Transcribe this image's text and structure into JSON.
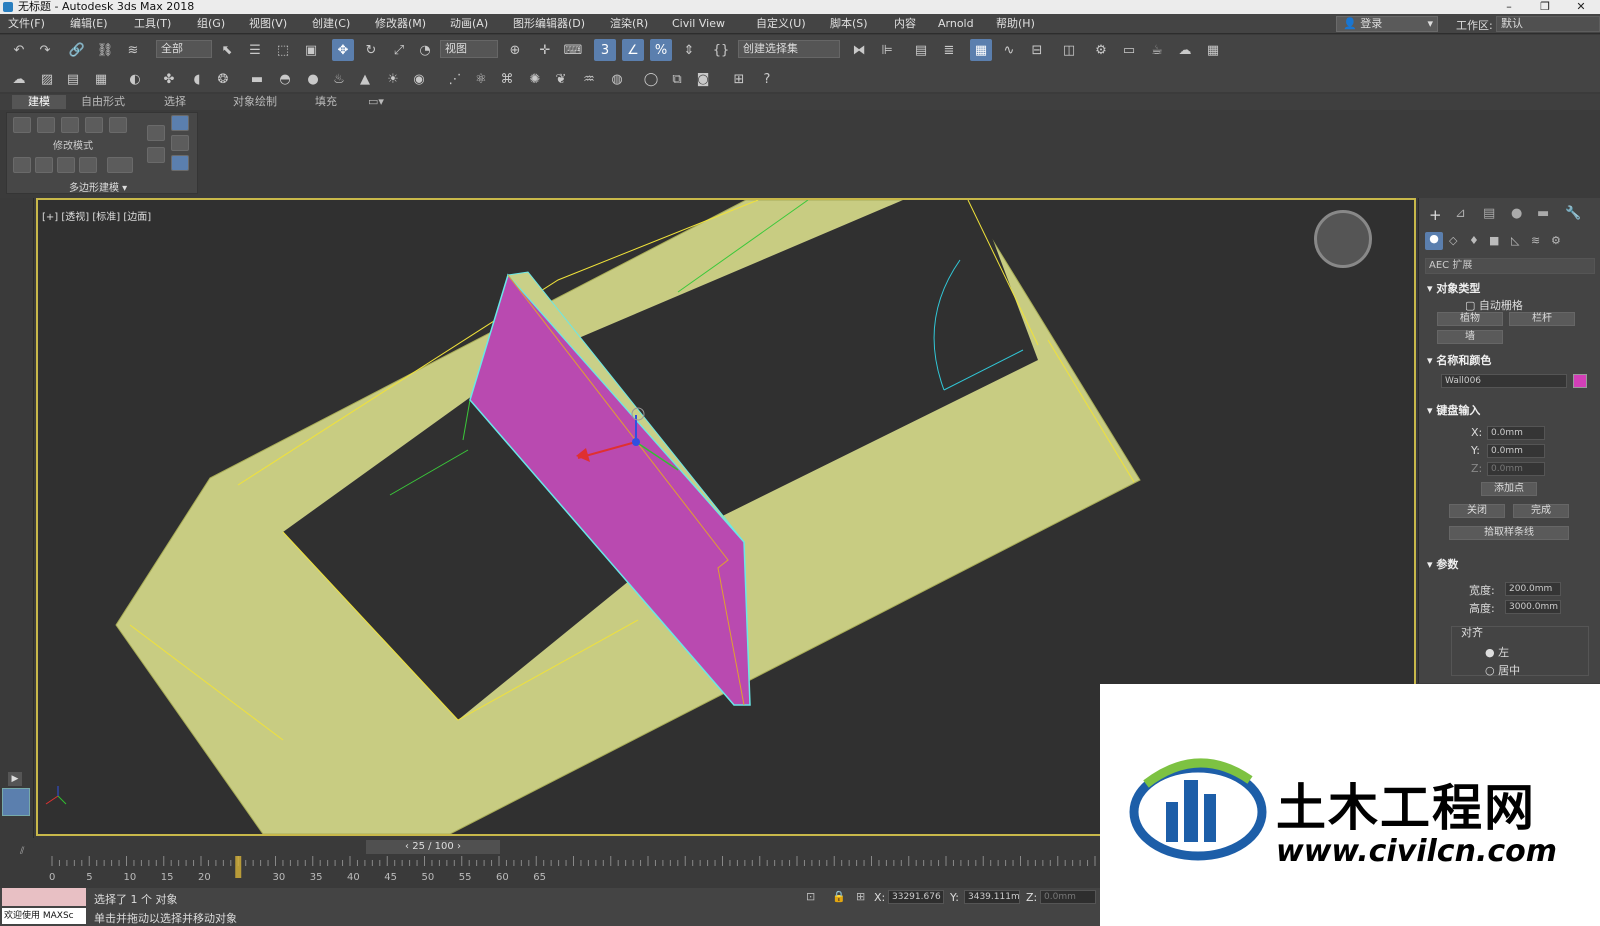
{
  "window": {
    "title": "无标题 - Autodesk 3ds Max 2018",
    "controls": [
      "–",
      "❐",
      "✕"
    ]
  },
  "menu": [
    "文件(F)",
    "编辑(E)",
    "工具(T)",
    "组(G)",
    "视图(V)",
    "创建(C)",
    "修改器(M)",
    "动画(A)",
    "图形编辑器(D)",
    "渲染(R)",
    "Civil View",
    "自定义(U)",
    "脚本(S)",
    "内容",
    "Arnold",
    "帮助(H)"
  ],
  "login": "登录",
  "workspace_label": "工作区:",
  "workspace_value": "默认",
  "toolbar": {
    "filter": "全部",
    "ref_coord": "视图",
    "selection_set": "创建选择集"
  },
  "ribbon": {
    "tabs": [
      "建模",
      "自由形式",
      "选择",
      "对象绘制",
      "填充"
    ],
    "active_tab": "建模",
    "group_label": "修改模式",
    "dropdown": "多边形建模 ▾"
  },
  "viewport": {
    "label": "[+] [透视] [标准] [边面]"
  },
  "cmd": {
    "category": "AEC 扩展",
    "rollout_object_type": "对象类型",
    "autogrid": "自动栅格",
    "btn_foliage": "植物",
    "btn_railing": "栏杆",
    "btn_wall": "墙",
    "rollout_name": "名称和颜色",
    "object_name": "Wall006",
    "object_color": "#d33fb8",
    "rollout_keyboard": "键盘输入",
    "x_label": "X:",
    "x_value": "0.0mm",
    "y_label": "Y:",
    "y_value": "0.0mm",
    "z_label": "Z:",
    "z_value": "0.0mm",
    "add_point": "添加点",
    "close": "关闭",
    "finish": "完成",
    "pick_spline": "拾取样条线",
    "rollout_params": "参数",
    "width_label": "宽度:",
    "width_value": "200.0mm",
    "height_label": "高度:",
    "height_value": "3000.0mm",
    "justify_label": "对齐",
    "justify_left": "左",
    "justify_center": "居中"
  },
  "timeline": {
    "frame": "25 / 100",
    "current_frame": 25,
    "ticks": [
      "0",
      "5",
      "10",
      "15",
      "20",
      "30",
      "35",
      "40",
      "45",
      "50",
      "55",
      "60",
      "65"
    ]
  },
  "status": {
    "selected": "选择了 1 个 对象",
    "hint": "单击并拖动以选择并移动对象",
    "welcome": "欢迎使用 MAXSc",
    "x_label": "X:",
    "x_value": "33291.676",
    "y_label": "Y:",
    "y_value": "3439.111m",
    "z_label": "Z:",
    "z_value": "0.0mm"
  },
  "watermark": {
    "brand": "土木工程网",
    "url": "www.civilcn.com"
  }
}
